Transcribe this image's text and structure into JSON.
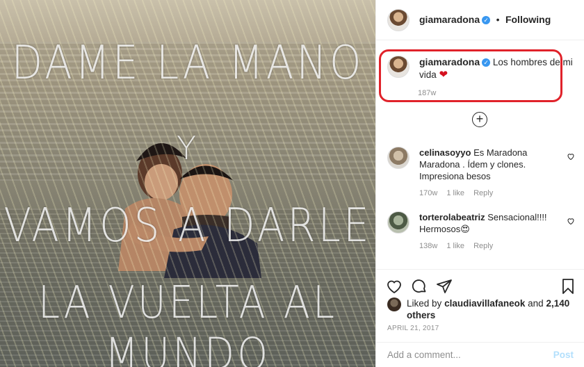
{
  "post": {
    "username": "giamaradona",
    "follow_status": "Following",
    "separator": "•",
    "verified_glyph": "✓"
  },
  "photo_text": {
    "line1": "DAME LA MANO",
    "line2": "Y",
    "line3": "VAMOS A DARLE",
    "line4": "LA VUELTA AL MUNDO"
  },
  "caption": {
    "username": "giamaradona",
    "text": "Los hombres de mi vida",
    "emoji": "❤",
    "time": "187w",
    "highlight_color": "#e0222a"
  },
  "load_more_label": "+",
  "comments": [
    {
      "username": "celinasoyyo",
      "text": "Es Maradona Maradona . Ídem y clones. Impresiona besos",
      "time": "170w",
      "likes": "1 like",
      "reply": "Reply"
    },
    {
      "username": "torterolabeatriz",
      "text": "Sensacional!!!! Hermosos😍",
      "time": "138w",
      "likes": "1 like",
      "reply": "Reply"
    }
  ],
  "likes": {
    "prefix": "Liked by",
    "user": "claudiavillafaneok",
    "and": "and",
    "others": "2,140 others"
  },
  "date": "APRIL 21, 2017",
  "add_comment": {
    "placeholder": "Add a comment...",
    "post_label": "Post"
  },
  "icons": {
    "like": "heart-icon",
    "comment": "comment-icon",
    "share": "share-icon",
    "save": "bookmark-icon",
    "comment_like": "heart-icon"
  },
  "colors": {
    "verified": "#3897f0",
    "post_disabled": "#b2dffc"
  }
}
